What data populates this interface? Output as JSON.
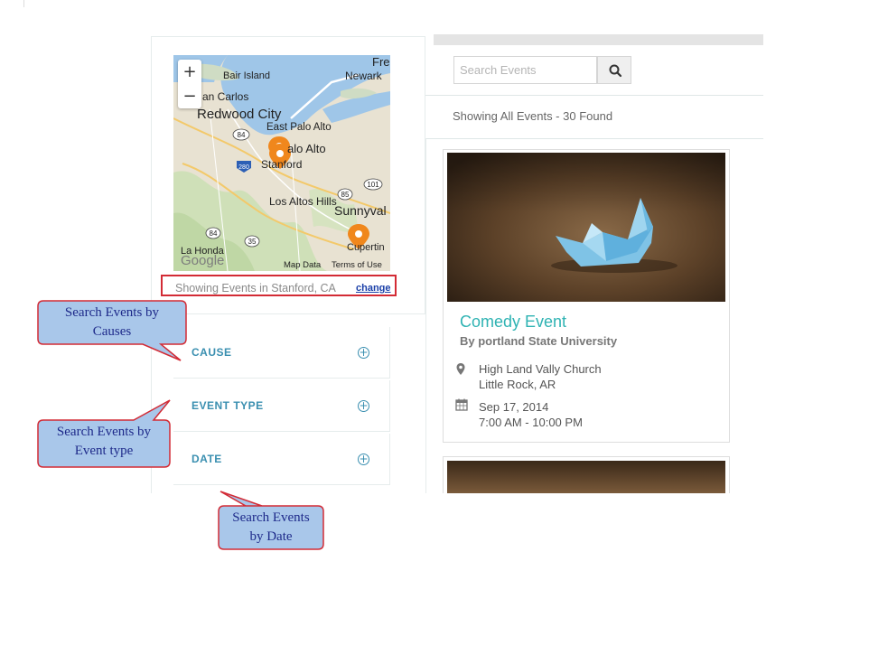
{
  "map": {
    "zoom_in": "+",
    "zoom_out": "−",
    "labels": [
      "Bair Island",
      "Newark",
      "Fre",
      "an Carlos",
      "Redwood City",
      "East Palo Alto",
      "alo Alto",
      "Stanford",
      "84",
      "280",
      "101",
      "85",
      "Los Altos Hills",
      "Sunnyval",
      "84",
      "35",
      "Cupertin",
      "La Honda",
      "Google",
      "Map Data",
      "Terms of Use"
    ]
  },
  "location": {
    "text": "Showing Events in Stanford, CA",
    "change_link": "change"
  },
  "filters": [
    {
      "label": "CAUSE"
    },
    {
      "label": "EVENT TYPE"
    },
    {
      "label": "DATE"
    }
  ],
  "search": {
    "placeholder": "Search Events"
  },
  "results": {
    "summary": "Showing All Events - 30 Found"
  },
  "event": {
    "title": "Comedy Event",
    "by": "By portland State University",
    "venue_line1": "High Land Vally Church",
    "venue_line2": "Little Rock, AR",
    "date": "Sep 17, 2014",
    "time": "7:00 AM - 10:00 PM"
  },
  "callouts": {
    "causes": [
      "Search Events by",
      "Causes"
    ],
    "event_type": [
      "Search Events by",
      "Event type"
    ],
    "date": [
      "Search Events",
      "by Date"
    ]
  },
  "colors": {
    "accent_teal": "#2fb3b3",
    "filter_blue": "#3a8fb0",
    "highlight_red": "#d32b35",
    "callout_fill": "#a9c7ea",
    "callout_border": "#d32b35",
    "marker_orange": "#f0871c"
  },
  "icons": {
    "search": "magnifier-icon",
    "pin": "map-pin-icon",
    "calendar": "calendar-icon",
    "filter_expand": "plus-circle-icon"
  }
}
